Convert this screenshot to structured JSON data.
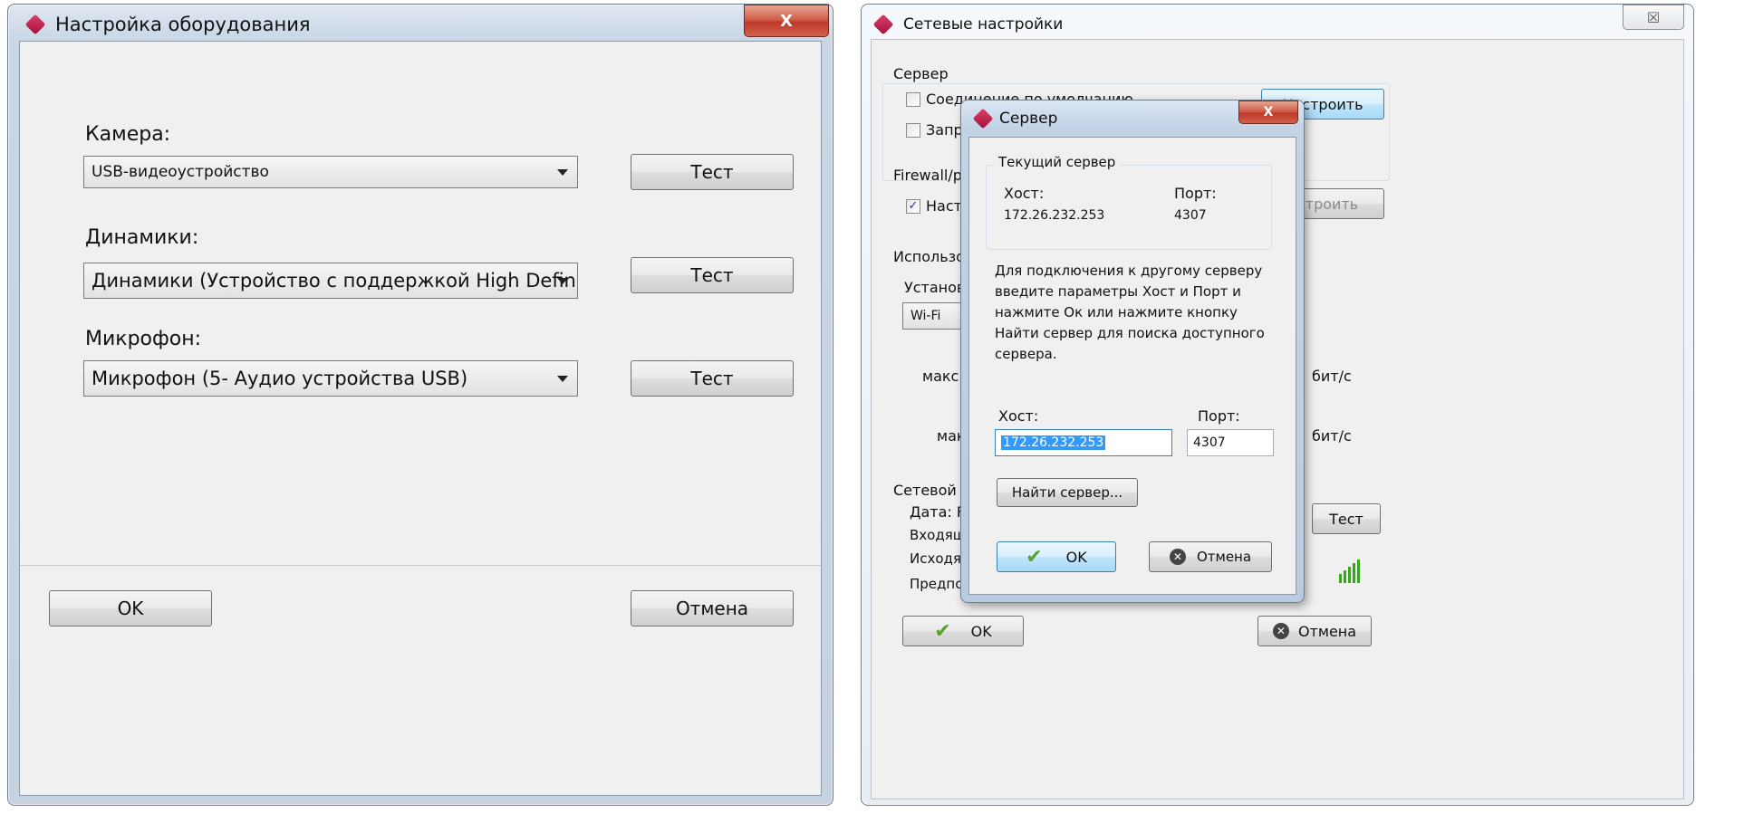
{
  "hw": {
    "title": "Настройка оборудования",
    "camera_label": "Камера:",
    "camera_value": "USB-видеоустройство",
    "speakers_label": "Динамики:",
    "speakers_value": "Динамики (Устройство с поддержкой High Definit",
    "mic_label": "Микрофон:",
    "mic_value": "Микрофон (5- Аудио устройства USB)",
    "test_label": "Тест",
    "ok_label": "OK",
    "cancel_label": "Отмена",
    "close_glyph": "X"
  },
  "net": {
    "title": "Сетевые настройки",
    "close_glyph": "☒",
    "server_group": "Сервер",
    "default_conn": "Соединение по умолчанию",
    "forbid": "Запре",
    "configure": "Настроить",
    "firewall_group": "Firewall/p",
    "firewall_chk": "Настр",
    "configure2": "троить",
    "usage_group": "Использо",
    "install": "Установ",
    "wifi": "Wi-Fi",
    "max1": "макс.",
    "bits1": "бит/с",
    "max2": "макс",
    "bits2": "бит/с",
    "traffic_group": "Сетевой т",
    "date": "Дата: F",
    "incoming": "Входящ",
    "outgoing": "Исходя",
    "expected": "Предпо",
    "test_label": "Тест",
    "ok_label": "OK",
    "cancel_label": "Отмена"
  },
  "srv": {
    "title": "Сервер",
    "close_glyph": "X",
    "current_group": "Текущий сервер",
    "host_label": "Хост:",
    "port_label": "Порт:",
    "host_value": "172.26.232.253",
    "port_value": "4307",
    "description": "Для подключения к другому серверу введите параметры Хост и Порт и нажмите Ок или нажмите кнопку Найти сервер для поиска доступного сервера.",
    "host_input_label": "Хост:",
    "port_input_label": "Порт:",
    "host_input_value": "172.26.232.253",
    "port_input_value": "4307",
    "find_server": "Найти сервер...",
    "ok_label": "OK",
    "cancel_label": "Отмена"
  },
  "signal_level": 5,
  "colors": {
    "accent": "#3399ff",
    "close_red": "#c0392b",
    "signal": "#3aa320"
  }
}
